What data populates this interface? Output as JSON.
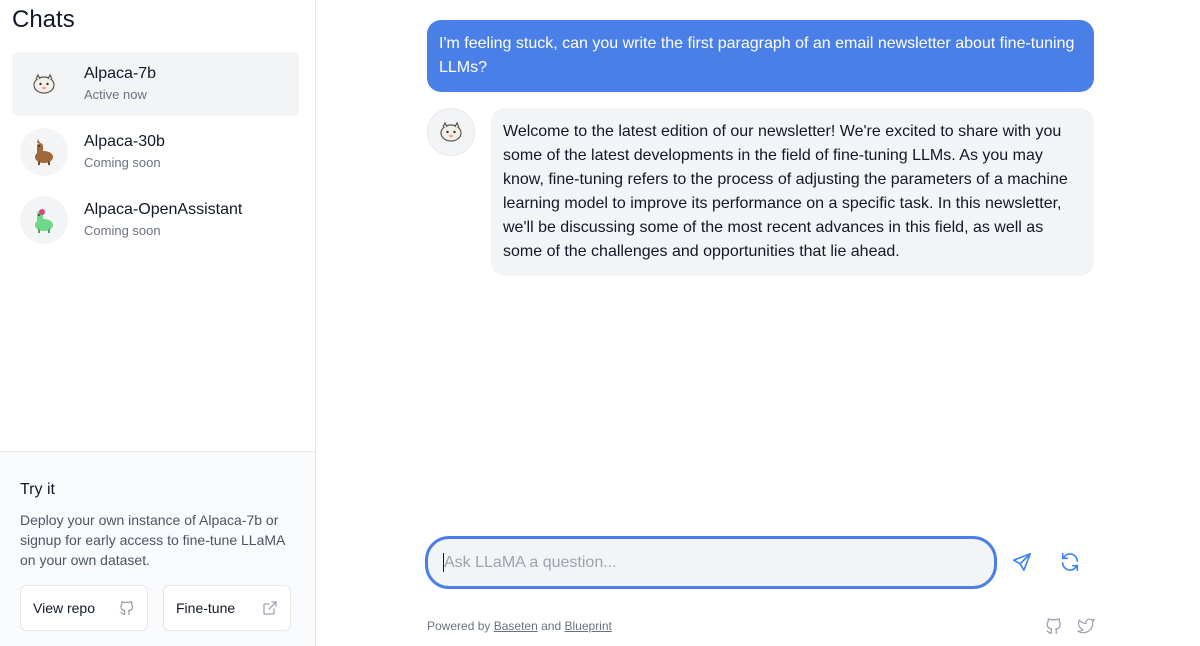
{
  "sidebar": {
    "title": "Chats",
    "chats": [
      {
        "name": "Alpaca-7b",
        "status": "Active now",
        "icon": "alpaca-icon"
      },
      {
        "name": "Alpaca-30b",
        "status": "Coming soon",
        "icon": "brown-alpaca-icon"
      },
      {
        "name": "Alpaca-OpenAssistant",
        "status": "Coming soon",
        "icon": "green-alpaca-icon"
      }
    ],
    "try_it": {
      "title": "Try it",
      "description": "Deploy your own instance of Alpaca-7b or signup for early access to fine-tune LLaMA on your own dataset.",
      "view_repo_label": "View repo",
      "fine_tune_label": "Fine-tune"
    }
  },
  "messages": {
    "user": "I'm feeling stuck, can you write the first paragraph of an email newsletter about fine-tuning LLMs?",
    "assistant": "Welcome to the latest edition of our newsletter! We're excited to share with you some of the latest developments in the field of fine-tuning LLMs. As you may know, fine-tuning refers to the process of adjusting the parameters of a machine learning model to improve its performance on a specific task. In this newsletter, we'll be discussing some of the most recent advances in this field, as well as some of the challenges and opportunities that lie ahead."
  },
  "composer": {
    "placeholder": "Ask LLaMA a question..."
  },
  "footer": {
    "prefix": "Powered by",
    "link1": "Baseten",
    "conjunction": "and",
    "link2": "Blueprint"
  },
  "colors": {
    "accent": "#4a7fe8",
    "bubble_gray": "#f3f4f6"
  }
}
